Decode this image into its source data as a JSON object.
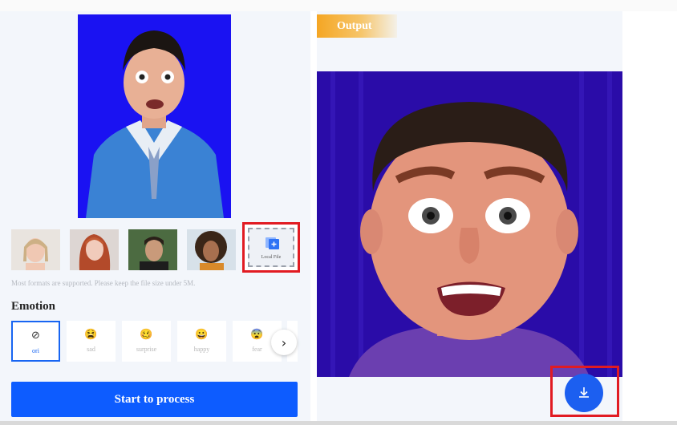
{
  "upload": {
    "local_file_label": "Local File",
    "hint": "Most formats are supported. Please keep the file size under 5M."
  },
  "emotion": {
    "title": "Emotion",
    "items": [
      {
        "label": "ori",
        "icon": "⊘",
        "selected": true
      },
      {
        "label": "sad",
        "icon": "😫"
      },
      {
        "label": "surprise",
        "icon": "🥴"
      },
      {
        "label": "happy",
        "icon": "😀"
      },
      {
        "label": "fear",
        "icon": "😨"
      }
    ]
  },
  "start_label": "Start to process",
  "output": {
    "tag": "Output"
  },
  "colors": {
    "accent": "#0d5cff",
    "highlight_box": "#e11b22",
    "output_tag": "#f5a623"
  }
}
